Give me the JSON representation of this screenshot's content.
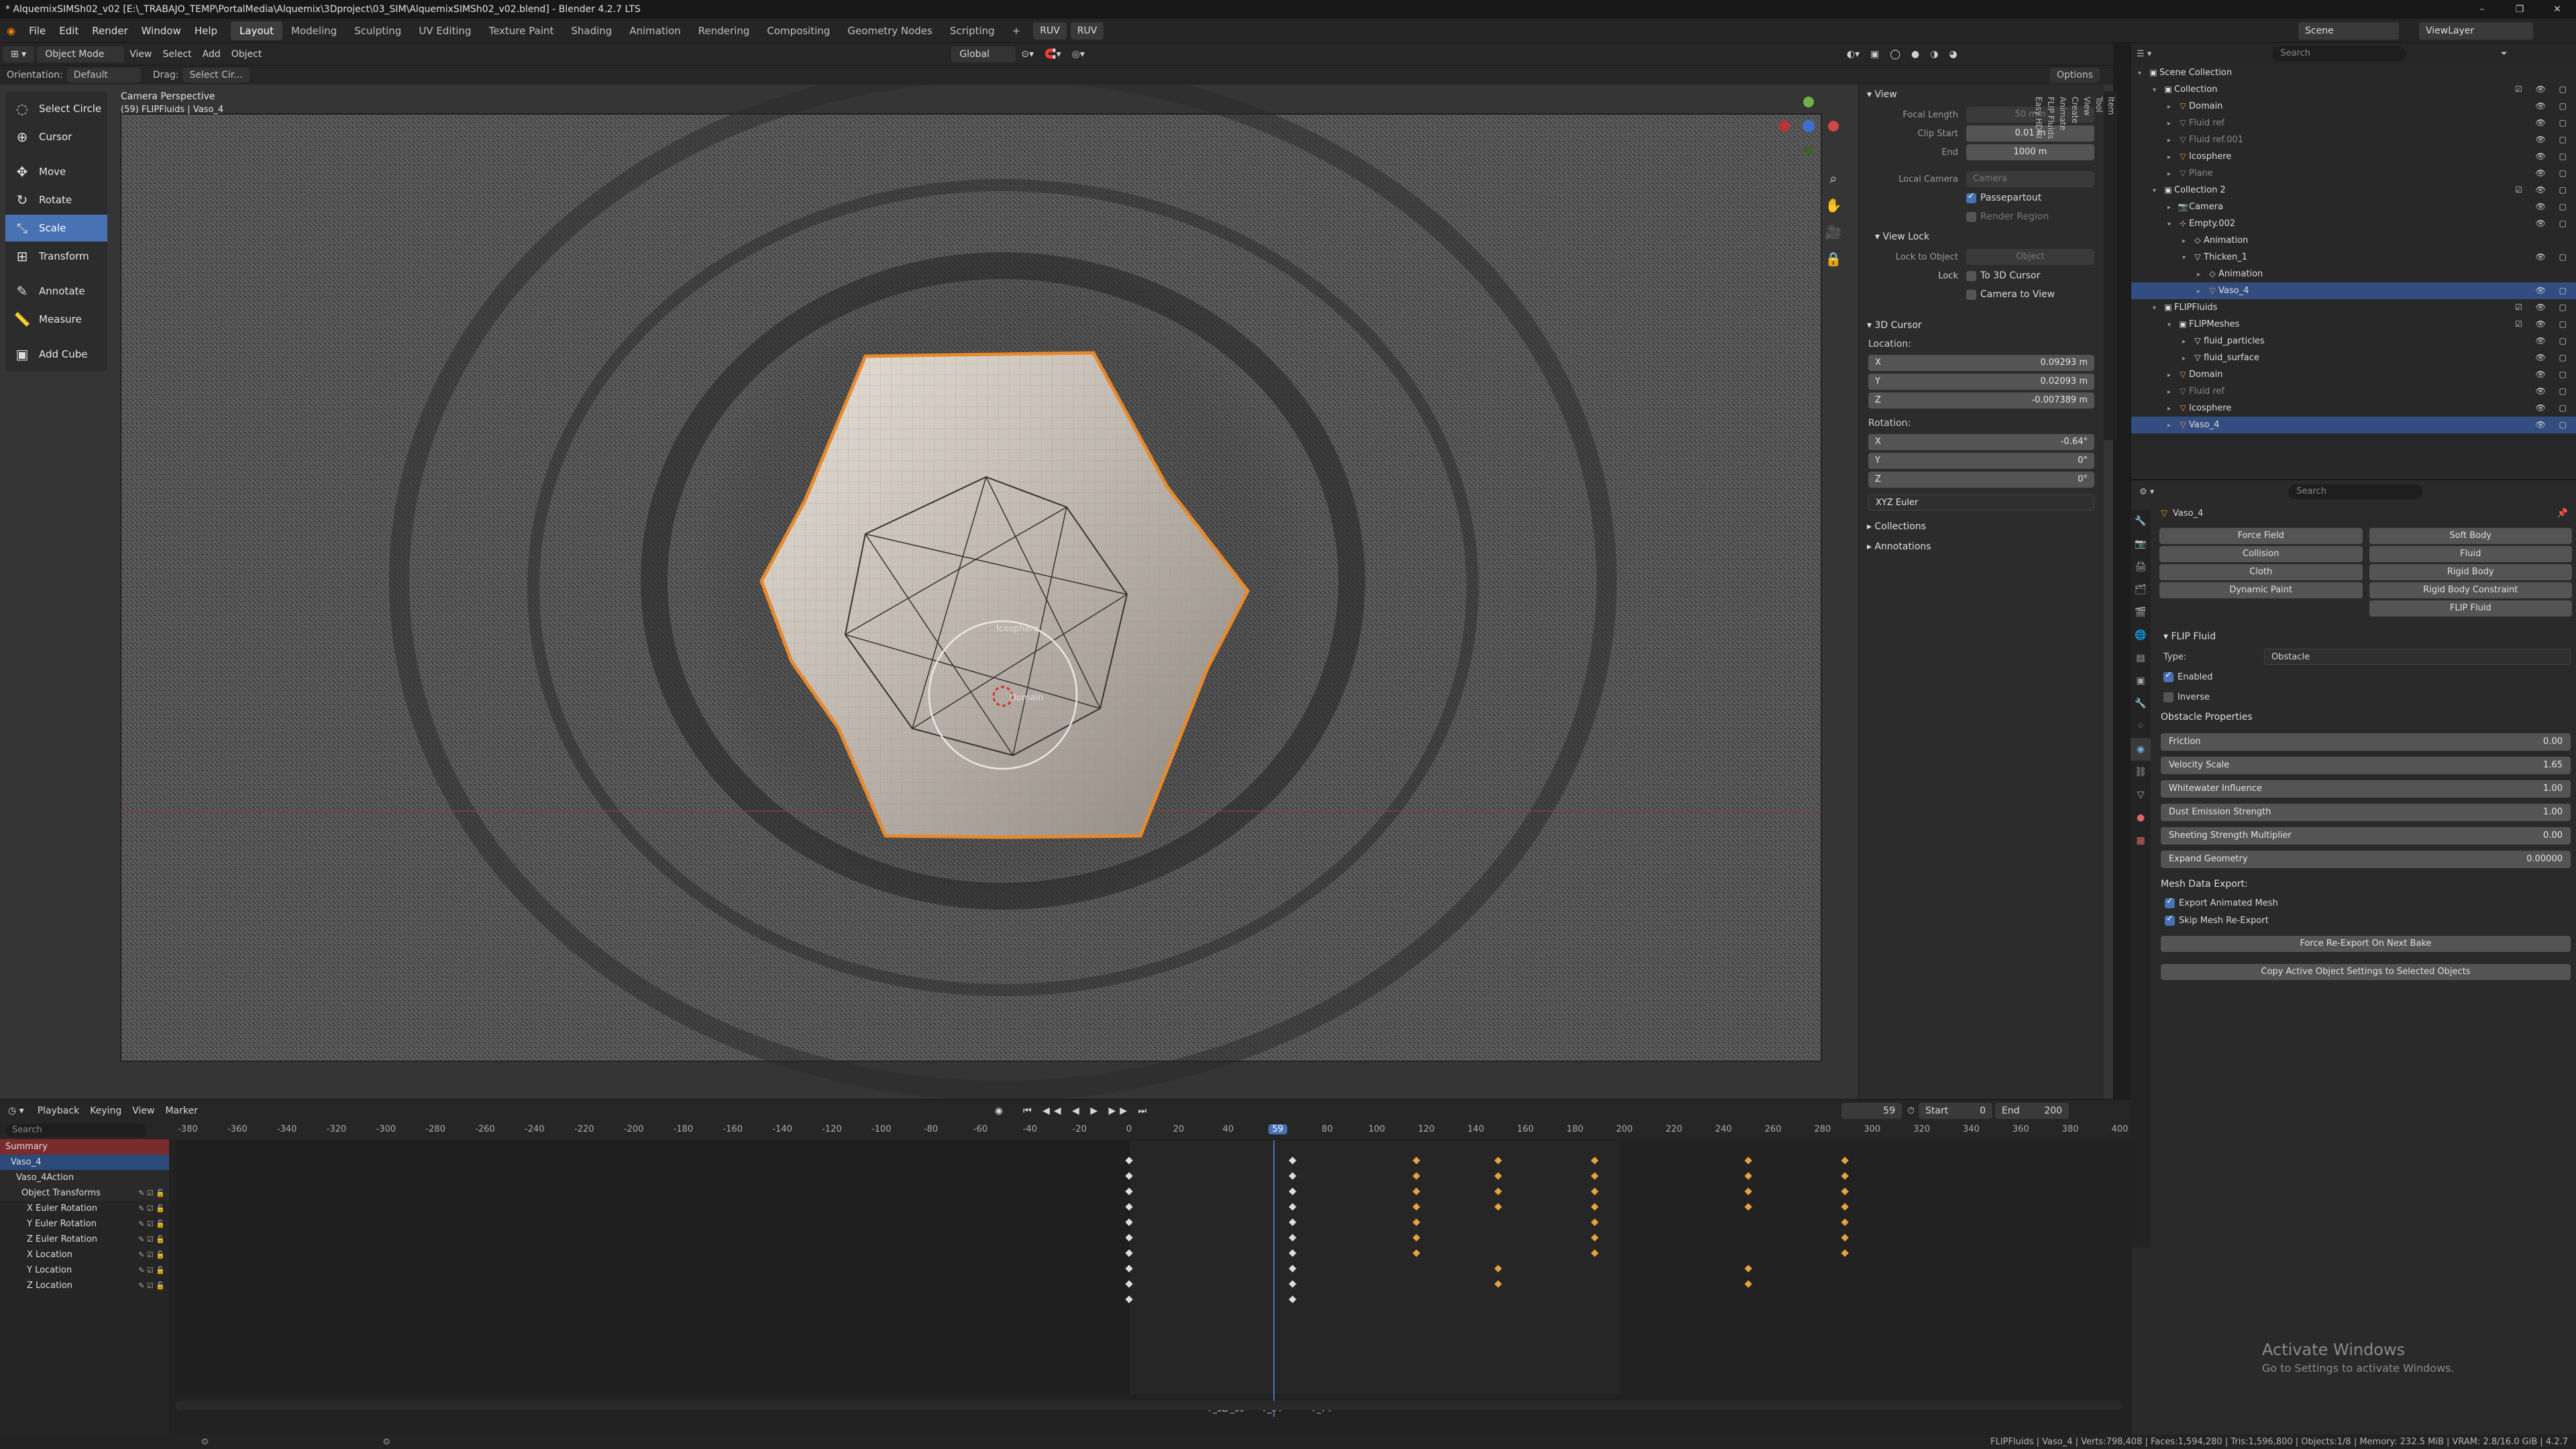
{
  "window": {
    "title": "* AlquemixSIMSh02_v02 [E:\\_TRABAJO_TEMP\\PortalMedia\\Alquemix\\3Dproject\\03_SIM\\AlquemixSIMSh02_v02.blend] - Blender 4.2.7 LTS",
    "min": "–",
    "max": "❐",
    "close": "✕"
  },
  "menubar": {
    "items": [
      "File",
      "Edit",
      "Render",
      "Window",
      "Help"
    ],
    "workspaces": [
      "Layout",
      "Modeling",
      "Sculpting",
      "UV Editing",
      "Texture Paint",
      "Shading",
      "Animation",
      "Rendering",
      "Compositing",
      "Geometry Nodes",
      "Scripting"
    ],
    "active_workspace": "Layout",
    "add": "+",
    "pill1": "RUV",
    "pill2": "RUV",
    "scene": "Scene",
    "viewlayer": "ViewLayer"
  },
  "header3d": {
    "mode": "Object Mode",
    "view": "View",
    "select": "Select",
    "add": "Add",
    "object": "Object",
    "transform": "Global",
    "options": "Options"
  },
  "header3d2": {
    "orientation_label": "Orientation:",
    "orientation": "Default",
    "drag_label": "Drag:",
    "drag": "Select Cir..."
  },
  "viewport": {
    "camera_label": "Camera Perspective",
    "object_label": "(59) FLIPFluids | Vaso_4",
    "obj_icosphere": "Icosphere",
    "obj_domain": "Domain"
  },
  "tools": [
    {
      "label": "Select Circle",
      "icon": "◌"
    },
    {
      "label": "Cursor",
      "icon": "⊕"
    },
    {
      "label": "Move",
      "icon": "✥"
    },
    {
      "label": "Rotate",
      "icon": "↻"
    },
    {
      "label": "Scale",
      "icon": "⤡"
    },
    {
      "label": "Transform",
      "icon": "⊞"
    },
    {
      "label": "Annotate",
      "icon": "✎"
    },
    {
      "label": "Measure",
      "icon": "📏"
    },
    {
      "label": "Add Cube",
      "icon": "▣"
    }
  ],
  "npanel": {
    "view_title": "View",
    "focal_label": "Focal Length",
    "focal": "50 mm",
    "clip_start_label": "Clip Start",
    "clip_start": "0.01 m",
    "end_label": "End",
    "end": "1000 m",
    "local_camera_label": "Local Camera",
    "local_camera": "Camera",
    "passepartout": "Passepartout",
    "render_region": "Render Region",
    "view_lock": "View Lock",
    "lock_object_label": "Lock to Object",
    "lock_object": "Object",
    "lock_label": "Lock",
    "to_3d_cursor": "To 3D Cursor",
    "camera_to_view": "Camera to View",
    "cursor_title": "3D Cursor",
    "location_label": "Location:",
    "loc_x": "0.09293 m",
    "loc_y": "0.02093 m",
    "loc_z": "-0.007389 m",
    "rotation_label": "Rotation:",
    "rot_x": "-0.64°",
    "rot_y": "0°",
    "rot_z": "0°",
    "euler": "XYZ Euler",
    "collections": "Collections",
    "annotations": "Annotations",
    "x": "X",
    "y": "Y",
    "z": "Z",
    "tabs": [
      "Item",
      "Tool",
      "View",
      "Create",
      "Animate",
      "FLIP Fluids",
      "Easy HDRI"
    ]
  },
  "outliner": {
    "search": "Search",
    "rows": [
      {
        "indent": 0,
        "tw": "▾",
        "icon": "▣",
        "cls": "",
        "label": "Scene Collection",
        "r": ""
      },
      {
        "indent": 1,
        "tw": "▾",
        "icon": "▣",
        "cls": "",
        "label": "Collection",
        "r": "☑ 👁 ▢"
      },
      {
        "indent": 2,
        "tw": "▸",
        "icon": "▽",
        "cls": "orange",
        "label": "Domain",
        "r": "👁 ▢"
      },
      {
        "indent": 2,
        "tw": "▸",
        "icon": "▽",
        "cls": "grey",
        "label": "Fluid ref",
        "r": "👁 ▢"
      },
      {
        "indent": 2,
        "tw": "▸",
        "icon": "▽",
        "cls": "grey",
        "label": "Fluid ref.001",
        "r": "👁 ▢"
      },
      {
        "indent": 2,
        "tw": "▸",
        "icon": "▽",
        "cls": "orange",
        "label": "Icosphere",
        "r": "👁 ▢"
      },
      {
        "indent": 2,
        "tw": "▸",
        "icon": "▽",
        "cls": "grey",
        "label": "Plane",
        "r": "👁 ▢"
      },
      {
        "indent": 1,
        "tw": "▾",
        "icon": "▣",
        "cls": "",
        "label": "Collection 2",
        "r": "☑ 👁 ▢"
      },
      {
        "indent": 2,
        "tw": "▸",
        "icon": "📷",
        "cls": "",
        "label": "Camera",
        "r": "👁 ▢"
      },
      {
        "indent": 2,
        "tw": "▾",
        "icon": "⊹",
        "cls": "",
        "label": "Empty.002",
        "r": "👁 ▢"
      },
      {
        "indent": 3,
        "tw": "▸",
        "icon": "◇",
        "cls": "",
        "label": "Animation",
        "r": ""
      },
      {
        "indent": 3,
        "tw": "▾",
        "icon": "▽",
        "cls": "",
        "label": "Thicken_1",
        "r": "👁 ▢"
      },
      {
        "indent": 4,
        "tw": "▸",
        "icon": "◇",
        "cls": "",
        "label": "Animation",
        "r": ""
      },
      {
        "indent": 4,
        "tw": "▸",
        "icon": "▽",
        "cls": "orange",
        "label": "Vaso_4",
        "r": "👁 ▢",
        "sel": true
      },
      {
        "indent": 1,
        "tw": "▾",
        "icon": "▣",
        "cls": "",
        "label": "FLIPFluids",
        "r": "☑ 👁 ▢"
      },
      {
        "indent": 2,
        "tw": "▾",
        "icon": "▣",
        "cls": "",
        "label": "FLIPMeshes",
        "r": "☑ 👁 ▢"
      },
      {
        "indent": 3,
        "tw": "▸",
        "icon": "▽",
        "cls": "",
        "label": "fluid_particles",
        "r": "👁 ▢"
      },
      {
        "indent": 3,
        "tw": "▸",
        "icon": "▽",
        "cls": "",
        "label": "fluid_surface",
        "r": "👁 ▢"
      },
      {
        "indent": 2,
        "tw": "▸",
        "icon": "▽",
        "cls": "orange",
        "label": "Domain",
        "r": "👁 ▢"
      },
      {
        "indent": 2,
        "tw": "▸",
        "icon": "▽",
        "cls": "grey",
        "label": "Fluid ref",
        "r": "👁 ▢"
      },
      {
        "indent": 2,
        "tw": "▸",
        "icon": "▽",
        "cls": "orange",
        "label": "Icosphere",
        "r": "👁 ▢"
      },
      {
        "indent": 2,
        "tw": "▸",
        "icon": "▽",
        "cls": "orange",
        "label": "Vaso_4",
        "r": "👁 ▢",
        "sel": true
      }
    ]
  },
  "props": {
    "search": "Search",
    "object": "Vaso_4",
    "physics_buttons": [
      [
        "Force Field",
        "Soft Body"
      ],
      [
        "Collision",
        "Fluid"
      ],
      [
        "Cloth",
        "Rigid Body"
      ],
      [
        "Dynamic Paint",
        "Rigid Body Constraint"
      ],
      [
        "",
        "FLIP Fluid"
      ]
    ],
    "flip_title": "FLIP Fluid",
    "type_label": "Type:",
    "type": "Obstacle",
    "enabled": "Enabled",
    "inverse": "Inverse",
    "obstacle_props": "Obstacle Properties",
    "sliders": [
      {
        "label": "Friction",
        "value": "0.00"
      },
      {
        "label": "Velocity Scale",
        "value": "1.65"
      },
      {
        "label": "Whitewater Influence",
        "value": "1.00"
      },
      {
        "label": "Dust Emission Strength",
        "value": "1.00"
      },
      {
        "label": "Sheeting Strength Multiplier",
        "value": "0.00"
      },
      {
        "label": "Expand Geometry",
        "value": "0.00000"
      }
    ],
    "mesh_export": "Mesh Data Export:",
    "export_anim": "Export Animated Mesh",
    "skip_reexport": "Skip Mesh Re-Export",
    "force_reexport": "Force Re-Export On Next Bake",
    "copy_settings": "Copy Active Object Settings to Selected Objects"
  },
  "timeline": {
    "playback": "Playback",
    "keying": "Keying",
    "view": "View",
    "marker": "Marker",
    "current_frame": "59",
    "start_label": "Start",
    "start": "0",
    "end_label": "End",
    "end": "200",
    "search": "Search",
    "ruler": [
      "-380",
      "-360",
      "-340",
      "-320",
      "-300",
      "-280",
      "-260",
      "-240",
      "-220",
      "-200",
      "-180",
      "-160",
      "-140",
      "-120",
      "-100",
      "-80",
      "-60",
      "-40",
      "-20",
      "0",
      "20",
      "40",
      "59",
      "80",
      "100",
      "120",
      "140",
      "160",
      "180",
      "200",
      "220",
      "240",
      "260",
      "280",
      "300",
      "320",
      "340",
      "360",
      "380",
      "400"
    ],
    "channels": [
      "Summary",
      "Vaso_4",
      "Vaso_4Action",
      "Object Transforms",
      "X Euler Rotation",
      "Y Euler Rotation",
      "Z Euler Rotation",
      "X Location",
      "Y Location",
      "Z Location"
    ],
    "markers": [
      "F_32",
      "F_39",
      "F_54",
      "F_74"
    ]
  },
  "statusbar": {
    "left1": "⊙",
    "left2": "⊙",
    "right": "FLIPFluids | Vaso_4 | Verts:798,408 | Faces:1,594,280 | Tris:1,596,800 | Objects:1/8 | Memory: 232.5 MiB | VRAM: 2.8/16.0 GiB | 4.2.7"
  },
  "activate": {
    "line1": "Activate Windows",
    "line2": "Go to Settings to activate Windows."
  }
}
